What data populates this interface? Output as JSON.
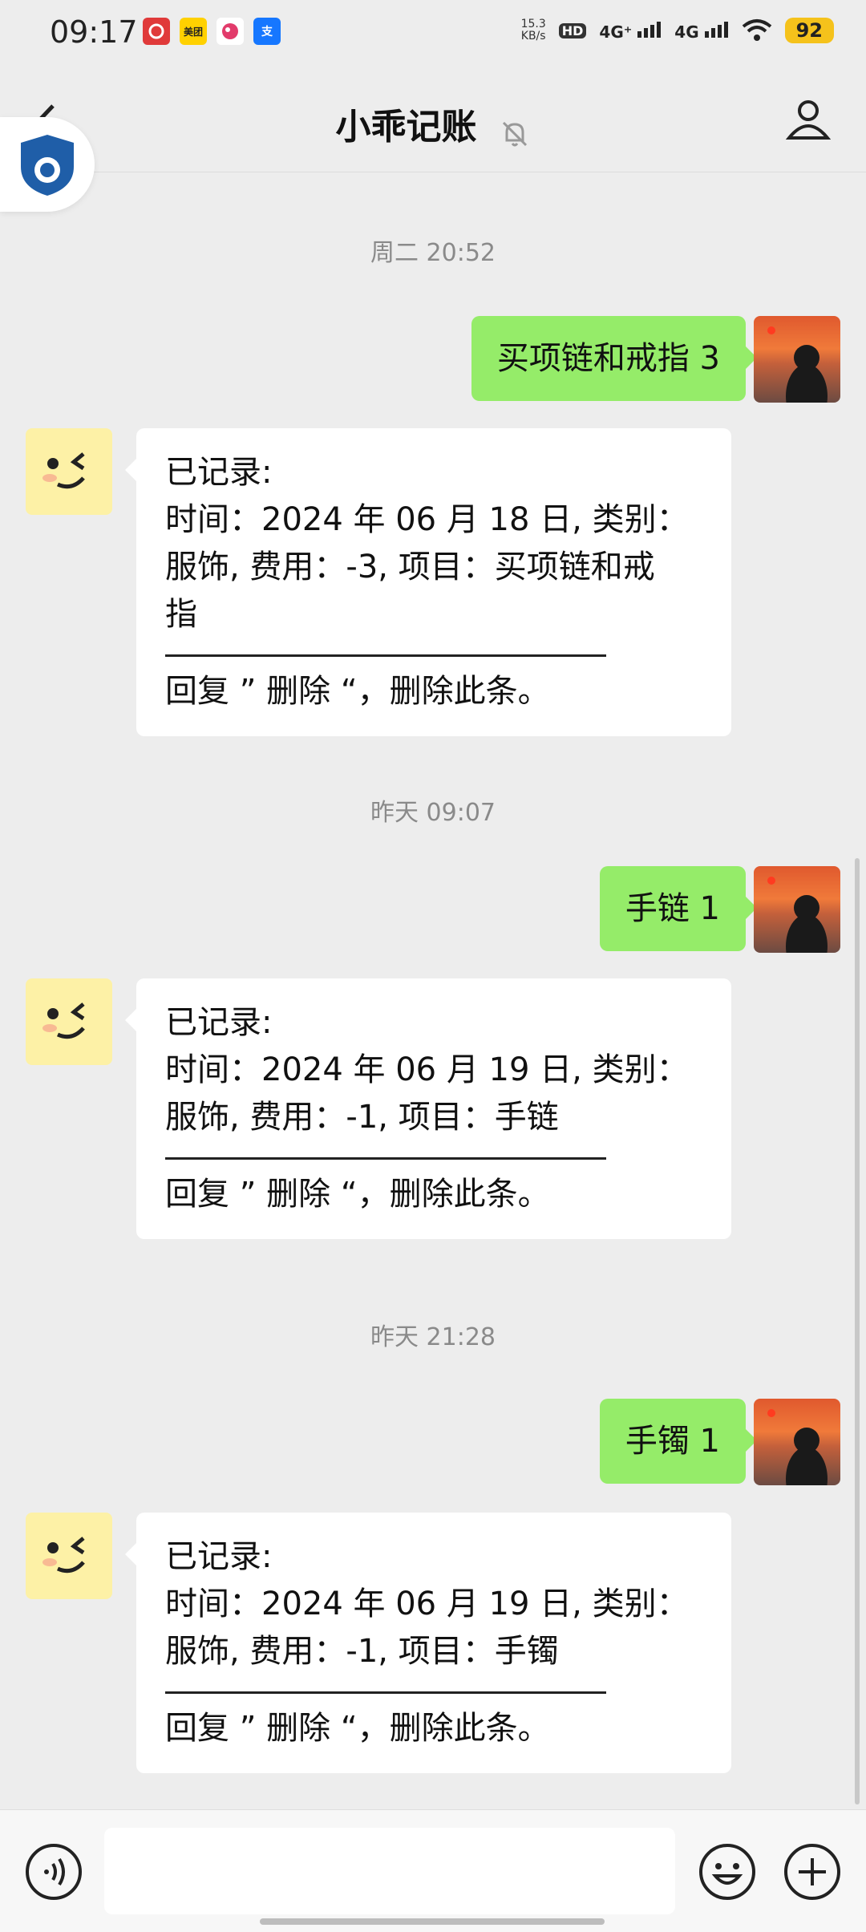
{
  "status_bar": {
    "time": "09:17",
    "net_speed_value": "15.3",
    "net_speed_unit": "KB/s",
    "hd_label": "HD",
    "signal1": "4G⁺",
    "signal2": "4G",
    "battery": "92",
    "app_icons": [
      "netease-music-icon",
      "meituan-icon",
      "app-icon",
      "alipay-icon"
    ],
    "meituan_text": "美团",
    "alipay_text": "支"
  },
  "header": {
    "title": "小乖记账"
  },
  "messages": [
    {
      "type": "timestamp",
      "text": "周二 20:52"
    },
    {
      "type": "user",
      "text": "买项链和戒指 3"
    },
    {
      "type": "bot",
      "lines": [
        "已记录:",
        "时间：2024 年 06 月 18 日, 类别：",
        "服饰, 费用：-3, 项目：买项链和戒",
        "指"
      ],
      "footer": "回复 ” 删除 “，删除此条。"
    },
    {
      "type": "timestamp",
      "text": "昨天 09:07"
    },
    {
      "type": "user",
      "text": "手链 1"
    },
    {
      "type": "bot",
      "lines": [
        "已记录:",
        "时间：2024 年 06 月 19 日, 类别：",
        "服饰, 费用：-1, 项目：手链"
      ],
      "footer": "回复 ” 删除 “，删除此条。"
    },
    {
      "type": "timestamp",
      "text": "昨天 21:28"
    },
    {
      "type": "user",
      "text": "手镯 1"
    },
    {
      "type": "bot",
      "lines": [
        "已记录:",
        "时间：2024 年 06 月 19 日, 类别：",
        "服饰, 费用：-1, 项目：手镯"
      ],
      "footer": "回复 ” 删除 “，删除此条。"
    }
  ],
  "colors": {
    "user_bubble": "#95ec69",
    "bot_bubble": "#ffffff",
    "background": "#ededed",
    "battery": "#f5c21b"
  }
}
